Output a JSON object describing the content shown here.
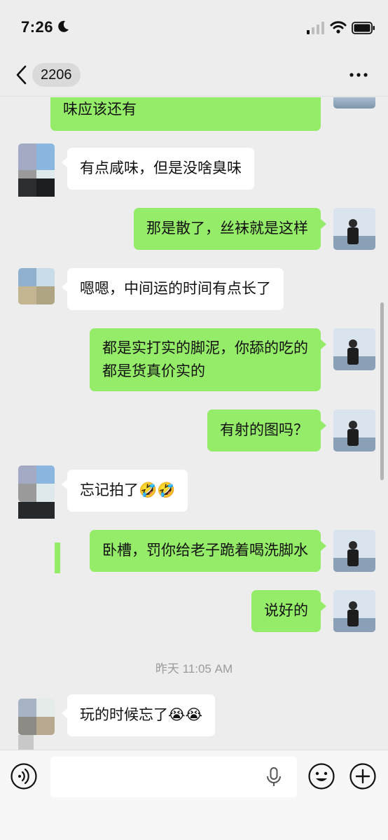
{
  "status_bar": {
    "time": "7:26"
  },
  "nav": {
    "title": "2206"
  },
  "messages": [
    {
      "side": "me",
      "text": "味应该还有"
    },
    {
      "side": "them",
      "text": "有点咸味，但是没啥臭味"
    },
    {
      "side": "me",
      "text": "那是散了，丝袜就是这样"
    },
    {
      "side": "them",
      "text": "嗯嗯，中间运的时间有点长了"
    },
    {
      "side": "me",
      "line1": "都是实打实的脚泥，你舔的吃的",
      "line2": "都是货真价实的"
    },
    {
      "side": "me",
      "text": "有射的图吗？"
    },
    {
      "side": "them",
      "text": "忘记拍了",
      "emoji": "🤣🤣"
    },
    {
      "side": "me",
      "text": "卧槽，罚你给老子跪着喝洗脚水"
    },
    {
      "side": "me",
      "text": "说好的"
    },
    {
      "side": "them",
      "text": "玩的时候忘了",
      "emoji": "😭😭"
    }
  ],
  "timestamp": "昨天 11:05 AM",
  "input": {
    "value": "",
    "placeholder": ""
  },
  "icons": {
    "back": "chevron-left-icon",
    "more": "more-dots-icon",
    "voice": "voice-input-icon",
    "mic": "microphone-icon",
    "emoji": "emoji-icon",
    "plus": "plus-icon"
  },
  "colors": {
    "my_bubble": "#95ec69",
    "their_bubble": "#ffffff",
    "background": "#ededed"
  }
}
